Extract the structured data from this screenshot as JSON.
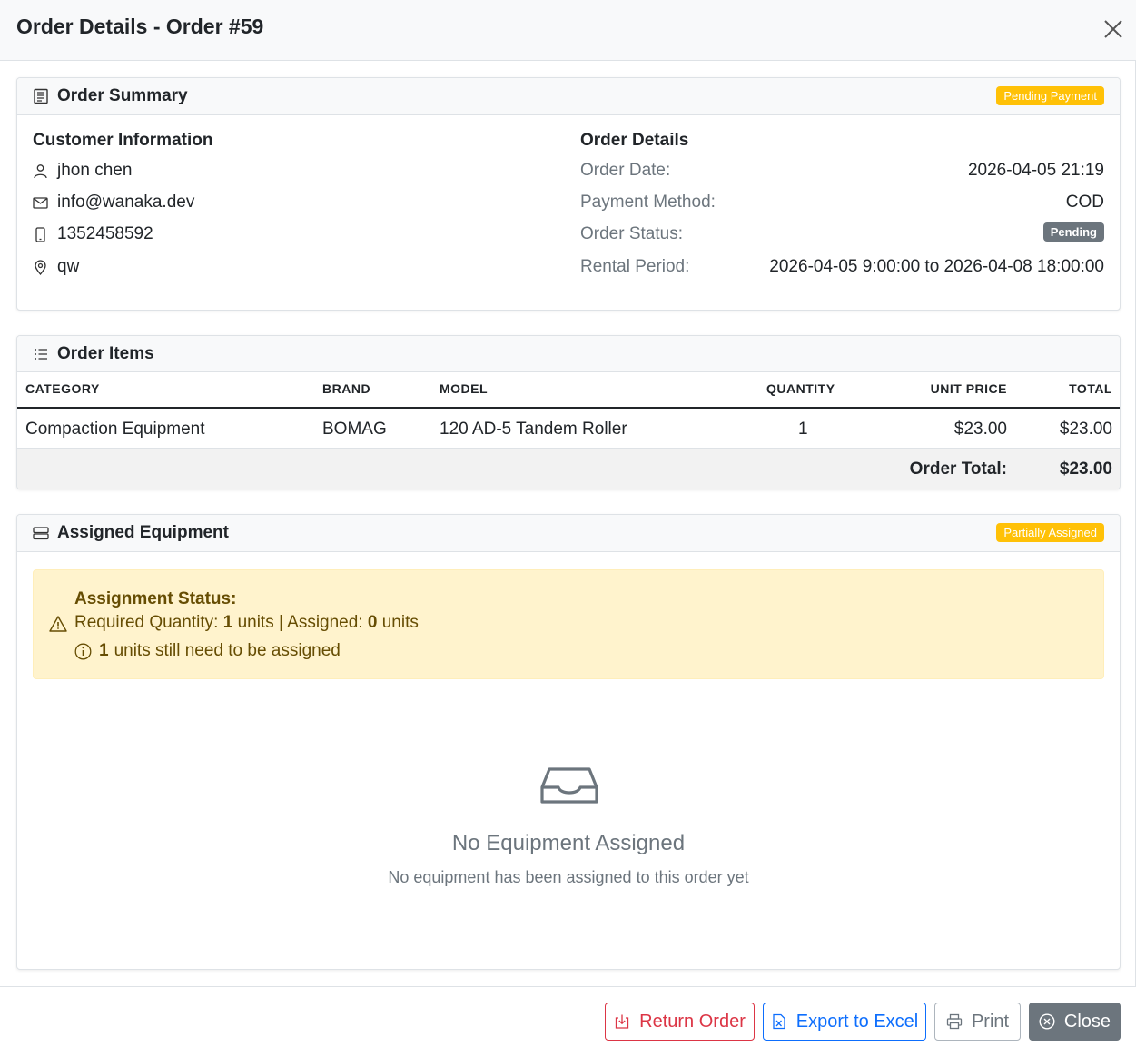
{
  "modal": {
    "title": "Order Details - Order #59"
  },
  "summary": {
    "title": "Order Summary",
    "status_badge": "Pending Payment",
    "customer_heading": "Customer Information",
    "customer": {
      "name": "jhon chen",
      "email": "info@wanaka.dev",
      "phone": "1352458592",
      "address": "qw"
    },
    "details_heading": "Order Details",
    "details": {
      "order_date_label": "Order Date:",
      "order_date": "2026-04-05 21:19",
      "payment_method_label": "Payment Method:",
      "payment_method": "COD",
      "order_status_label": "Order Status:",
      "order_status": "Pending",
      "rental_period_label": "Rental Period:",
      "rental_period": "2026-04-05 9:00:00 to 2026-04-08 18:00:00"
    }
  },
  "items": {
    "title": "Order Items",
    "columns": [
      "CATEGORY",
      "BRAND",
      "MODEL",
      "QUANTITY",
      "UNIT PRICE",
      "TOTAL"
    ],
    "rows": [
      {
        "category": "Compaction Equipment",
        "brand": "BOMAG",
        "model": "120 AD-5 Tandem Roller",
        "quantity": "1",
        "unit_price": "$23.00",
        "total": "$23.00"
      }
    ],
    "order_total_label": "Order Total:",
    "order_total": "$23.00"
  },
  "assigned": {
    "title": "Assigned Equipment",
    "status_badge": "Partially Assigned",
    "alert": {
      "title": "Assignment Status:",
      "required_prefix": "Required Quantity:",
      "required_value": "1",
      "required_units": "units | Assigned:",
      "assigned_value": "0",
      "assigned_units": "units",
      "remaining_value": "1",
      "remaining_text": "units still need to be assigned"
    },
    "empty_title": "No Equipment Assigned",
    "empty_subtitle": "No equipment has been assigned to this order yet"
  },
  "footer": {
    "return_label": "Return Order",
    "export_label": "Export to Excel",
    "print_label": "Print",
    "close_label": "Close"
  },
  "colors": {
    "warning": "#ffc107",
    "danger": "#dc3545",
    "primary": "#0d6efd",
    "secondary": "#6c757d"
  }
}
